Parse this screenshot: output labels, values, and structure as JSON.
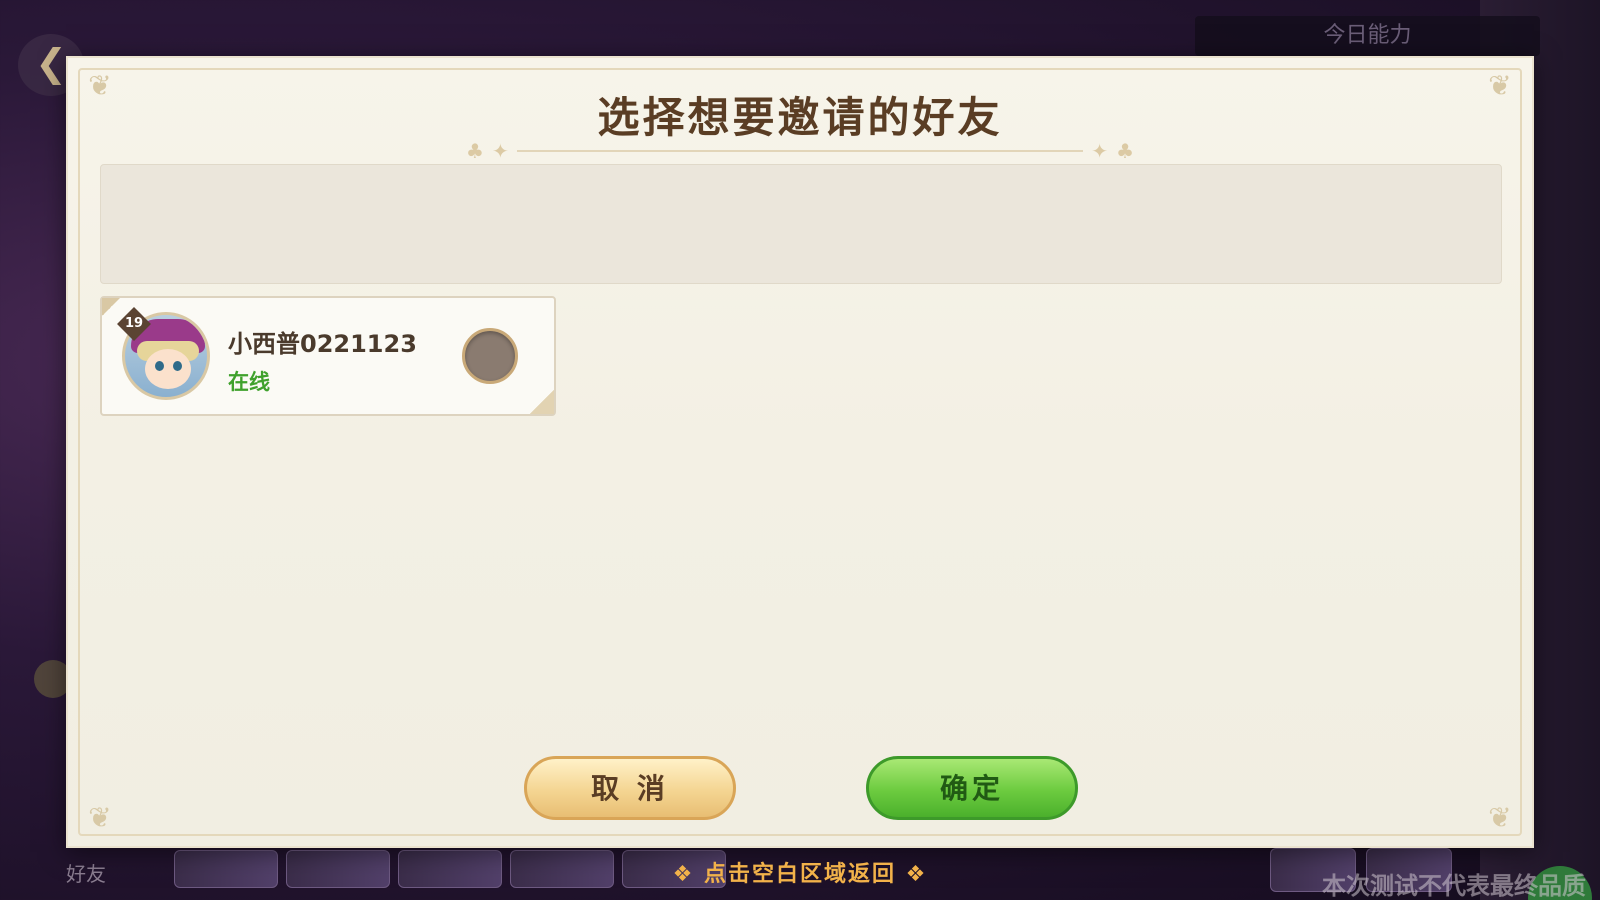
{
  "background": {
    "power_label": "今日能力",
    "left_label": "好友",
    "watermark": "本次测试不代表最终品质"
  },
  "dialog": {
    "title": "选择想要邀请的好友",
    "search_bar": {
      "placeholder": ""
    },
    "friends": [
      {
        "name": "小西普0221123",
        "status": "在线",
        "level": "19",
        "selected": false
      }
    ],
    "buttons": {
      "cancel_label": "取 消",
      "confirm_label": "确定"
    }
  },
  "hint": "点击空白区域返回",
  "colors": {
    "title": "#5a3d24",
    "status_online": "#3fa12c",
    "confirm_green": "#6ccb3f",
    "cancel_gold": "#f4d592",
    "hint_orange": "#f2b24a"
  },
  "icons": {
    "back": "back-arrow-icon",
    "chat": "chat-bubble-icon",
    "title_deco": "clover-icon"
  }
}
